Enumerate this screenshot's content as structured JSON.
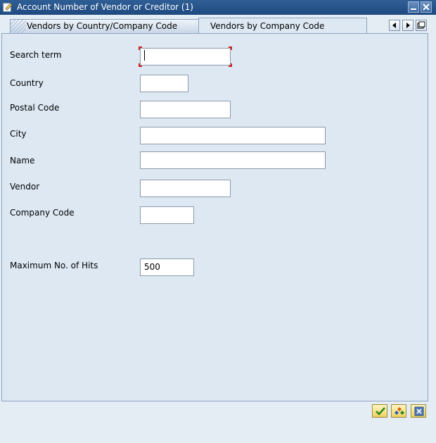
{
  "window": {
    "title": "Account Number of Vendor or Creditor (1)",
    "minimize_icon": "minimize-icon",
    "close_icon": "close-icon"
  },
  "tabs": [
    {
      "label": "Vendors by Country/Company Code",
      "active": false
    },
    {
      "label": "Vendors by Company Code",
      "active": true
    }
  ],
  "tab_nav": [
    "scroll-left-icon",
    "scroll-right-icon",
    "tab-list-icon"
  ],
  "form": {
    "search_term": {
      "label": "Search term",
      "value": ""
    },
    "country": {
      "label": "Country",
      "value": ""
    },
    "postal_code": {
      "label": "Postal Code",
      "value": ""
    },
    "city": {
      "label": "City",
      "value": ""
    },
    "name": {
      "label": "Name",
      "value": ""
    },
    "vendor": {
      "label": "Vendor",
      "value": ""
    },
    "company_code": {
      "label": "Company Code",
      "value": ""
    },
    "max_hits": {
      "label": "Maximum No. of Hits",
      "value": "500"
    }
  },
  "footer": {
    "buttons": [
      "check-icon",
      "multiple-selection-icon",
      "cancel-icon"
    ]
  },
  "colors": {
    "title_bar": "#1f4a80",
    "panel": "#dde8f3",
    "focus_marker": "#d02020",
    "button": "#f0d060"
  }
}
